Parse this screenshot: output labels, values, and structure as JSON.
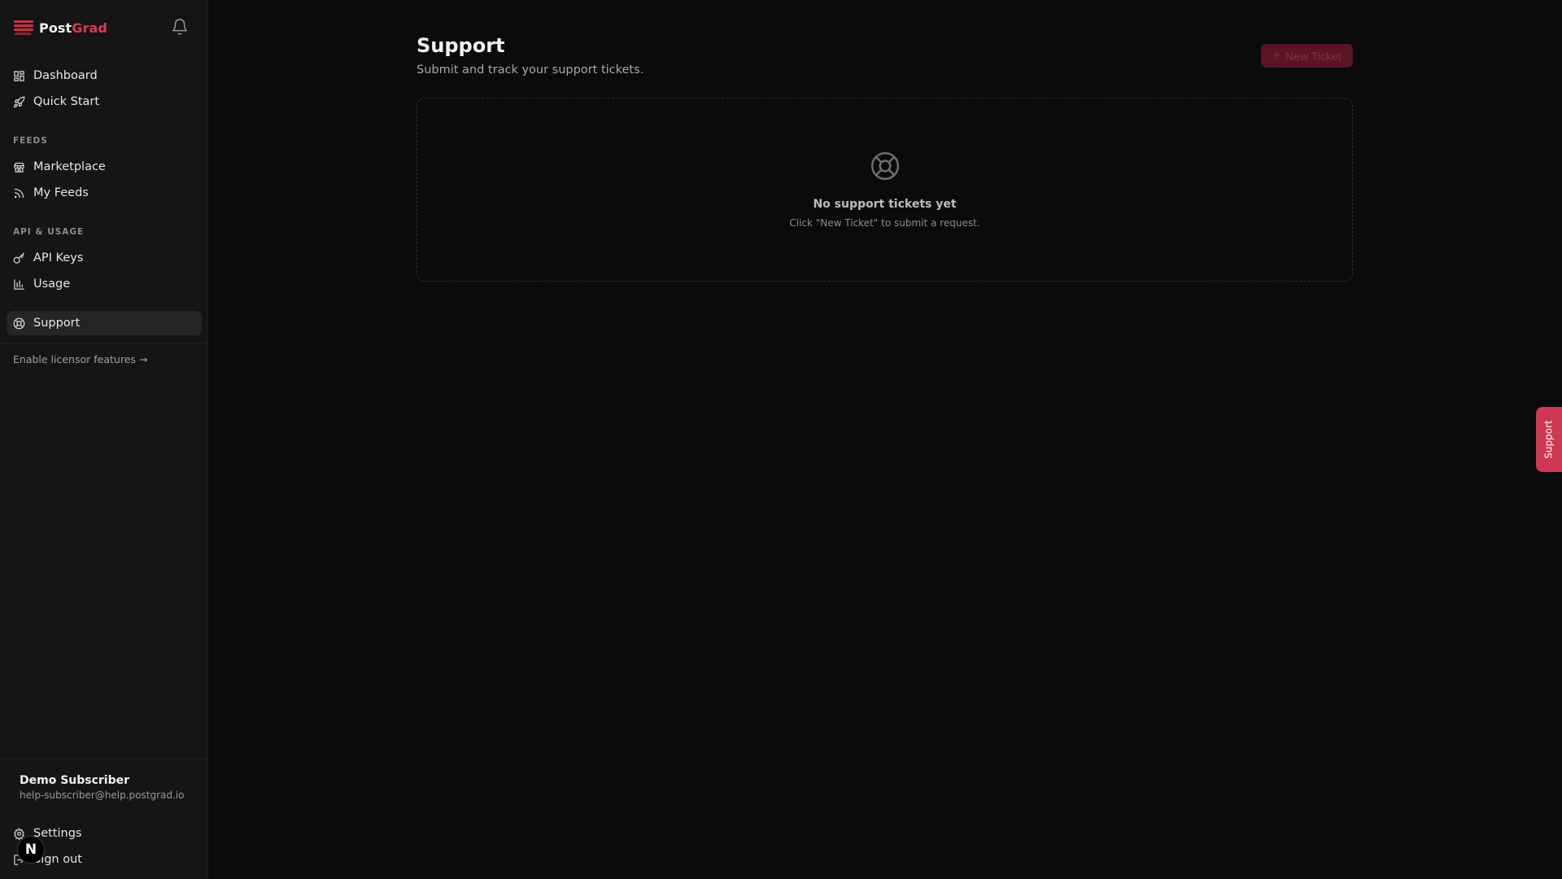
{
  "brand": {
    "name_part1": "Post",
    "name_part2": "Grad",
    "accent_color": "#d93a55"
  },
  "sidebar": {
    "top_items": [
      {
        "label": "Dashboard",
        "icon": "dashboard-icon"
      },
      {
        "label": "Quick Start",
        "icon": "rocket-icon"
      }
    ],
    "sections": [
      {
        "label": "FEEDS",
        "items": [
          {
            "label": "Marketplace",
            "icon": "store-icon"
          },
          {
            "label": "My Feeds",
            "icon": "rss-icon"
          }
        ]
      },
      {
        "label": "API & USAGE",
        "items": [
          {
            "label": "API Keys",
            "icon": "key-icon"
          },
          {
            "label": "Usage",
            "icon": "bar-chart-icon"
          }
        ]
      }
    ],
    "support_item": {
      "label": "Support",
      "icon": "lifebuoy-icon",
      "active": true
    },
    "licensor_link": "Enable licensor features →",
    "user": {
      "name": "Demo Subscriber",
      "email": "help-subscriber@help.postgrad.io"
    },
    "settings_label": "Settings",
    "signout_label": "Sign out"
  },
  "main": {
    "title": "Support",
    "subtitle": "Submit and track your support tickets.",
    "new_ticket_label": "New Ticket",
    "empty_state": {
      "title": "No support tickets yet",
      "hint": "Click \"New Ticket\" to submit a request."
    }
  },
  "floating_support_tab": "Support",
  "next_badge": "N"
}
